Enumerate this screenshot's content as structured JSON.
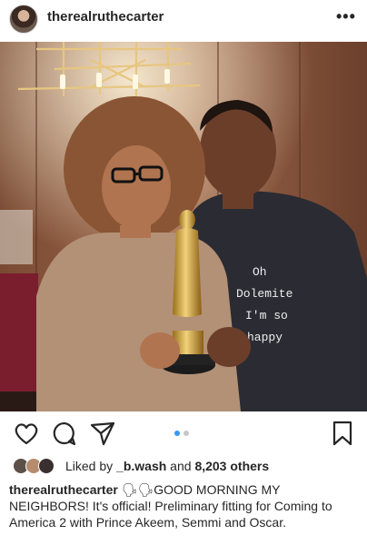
{
  "post": {
    "username": "therealruthecarter",
    "more_label": "•••"
  },
  "likes": {
    "prefix": "Liked by ",
    "user": "_b.wash",
    "middle": " and ",
    "count": "8,203 others"
  },
  "caption": {
    "username": "therealruthecarter",
    "emoji": "🗣🗣",
    "text": "GOOD MORNING MY NEIGHBORS! It's official! Preliminary fitting for Coming to America 2 with Prince Akeem, Semmi and Oscar."
  },
  "photo": {
    "shirt_text": [
      "Oh",
      "Dolemite",
      "I'm so",
      "happy"
    ]
  },
  "carousel": {
    "total": 2,
    "active": 1
  },
  "icons": [
    "more-icon",
    "heart-icon",
    "comment-icon",
    "share-icon",
    "bookmark-icon"
  ],
  "colors": {
    "accent": "#3897f0",
    "text": "#262626",
    "muted": "#c7c7c7"
  }
}
